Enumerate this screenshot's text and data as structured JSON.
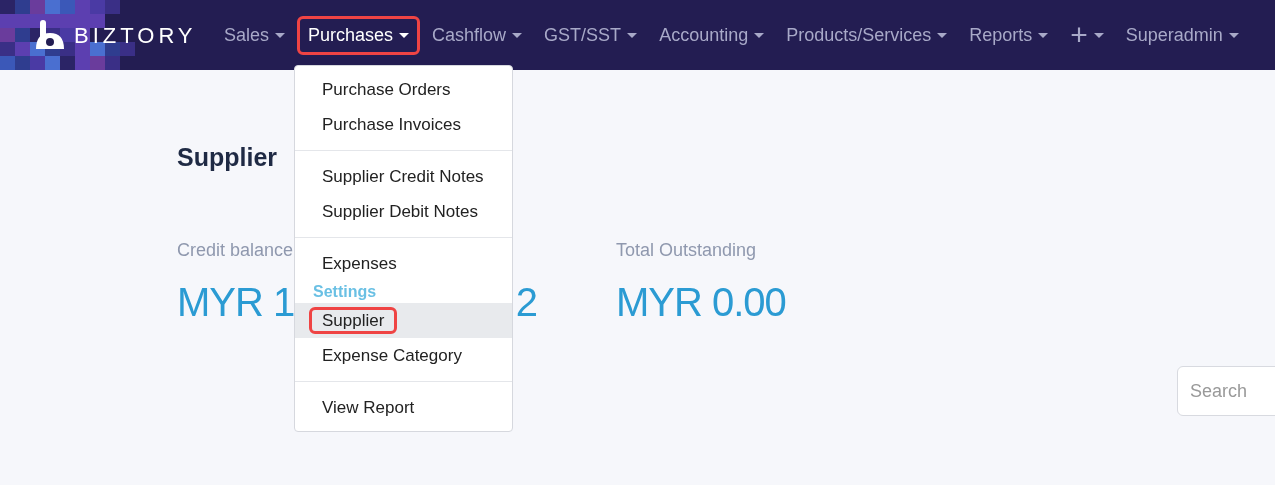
{
  "navbar": {
    "brand": "BIZTORY",
    "menus": [
      {
        "label": "Sales",
        "selected": false,
        "highlighted": false
      },
      {
        "label": "Purchases",
        "selected": true,
        "highlighted": true
      },
      {
        "label": "Cashflow",
        "selected": false,
        "highlighted": false
      },
      {
        "label": "GST/SST",
        "selected": false,
        "highlighted": false
      },
      {
        "label": "Accounting",
        "selected": false,
        "highlighted": false
      },
      {
        "label": "Products/Services",
        "selected": false,
        "highlighted": false
      },
      {
        "label": "Reports",
        "selected": false,
        "highlighted": false
      },
      {
        "label": "+",
        "selected": false,
        "highlighted": false
      },
      {
        "label": "Superadmin",
        "selected": false,
        "highlighted": false
      }
    ]
  },
  "dropdown": {
    "groups": [
      {
        "items": [
          {
            "kind": "link",
            "label": "Purchase Orders",
            "selected": false,
            "highlighted": false
          },
          {
            "kind": "link",
            "label": "Purchase Invoices",
            "selected": false,
            "highlighted": false
          }
        ]
      },
      {
        "items": [
          {
            "kind": "link",
            "label": "Supplier Credit Notes",
            "selected": false,
            "highlighted": false
          },
          {
            "kind": "link",
            "label": "Supplier Debit Notes",
            "selected": false,
            "highlighted": false
          }
        ]
      },
      {
        "items": [
          {
            "kind": "link",
            "label": "Expenses",
            "selected": false,
            "highlighted": false
          },
          {
            "kind": "header",
            "label": "Settings"
          },
          {
            "kind": "link",
            "label": "Supplier",
            "selected": true,
            "highlighted": true
          },
          {
            "kind": "link",
            "label": "Expense Category",
            "selected": false,
            "highlighted": false
          }
        ]
      },
      {
        "items": [
          {
            "kind": "link",
            "label": "View Report",
            "selected": false,
            "highlighted": false
          }
        ]
      }
    ]
  },
  "page": {
    "title": "Supplier",
    "stats": [
      {
        "label": "Credit balance",
        "value_parts": [
          "MYR 1",
          "2"
        ]
      },
      {
        "label": "Total Outstanding",
        "value_parts": [
          "MYR 0.00"
        ]
      }
    ],
    "search": {
      "placeholder": "Search"
    }
  }
}
